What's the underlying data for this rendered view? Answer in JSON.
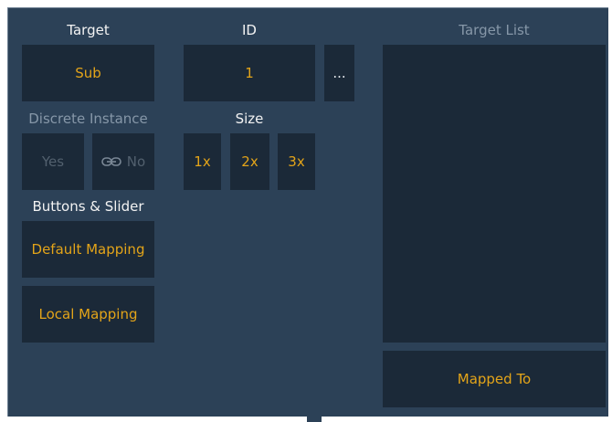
{
  "target": {
    "heading": "Target",
    "value": "Sub"
  },
  "id": {
    "heading": "ID",
    "value": "1",
    "more_label": "..."
  },
  "target_list": {
    "heading": "Target List"
  },
  "discrete_instance": {
    "heading": "Discrete Instance",
    "yes_label": "Yes",
    "no_label": "No",
    "link_icon": "link-icon"
  },
  "size": {
    "heading": "Size",
    "options": [
      "1x",
      "2x",
      "3x"
    ]
  },
  "buttons_slider": {
    "heading": "Buttons & Slider",
    "default_mapping": "Default Mapping",
    "local_mapping": "Local Mapping"
  },
  "mapped_to_label": "Mapped To",
  "colors": {
    "panel_bg": "#2c4157",
    "button_bg": "#1b2938",
    "accent": "#e3a419",
    "heading": "#f3f3f3",
    "dim_heading": "#8697a8"
  }
}
